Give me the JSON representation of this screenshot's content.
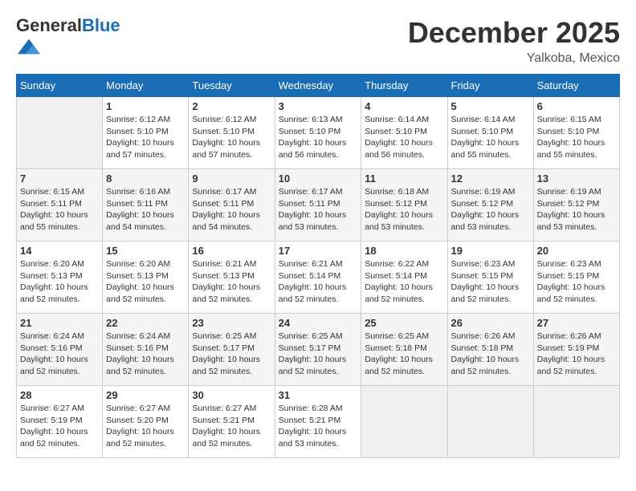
{
  "header": {
    "logo_general": "General",
    "logo_blue": "Blue",
    "month_title": "December 2025",
    "location": "Yalkoba, Mexico"
  },
  "columns": [
    "Sunday",
    "Monday",
    "Tuesday",
    "Wednesday",
    "Thursday",
    "Friday",
    "Saturday"
  ],
  "weeks": [
    [
      {
        "day": "",
        "info": ""
      },
      {
        "day": "1",
        "info": "Sunrise: 6:12 AM\nSunset: 5:10 PM\nDaylight: 10 hours and 57 minutes."
      },
      {
        "day": "2",
        "info": "Sunrise: 6:12 AM\nSunset: 5:10 PM\nDaylight: 10 hours and 57 minutes."
      },
      {
        "day": "3",
        "info": "Sunrise: 6:13 AM\nSunset: 5:10 PM\nDaylight: 10 hours and 56 minutes."
      },
      {
        "day": "4",
        "info": "Sunrise: 6:14 AM\nSunset: 5:10 PM\nDaylight: 10 hours and 56 minutes."
      },
      {
        "day": "5",
        "info": "Sunrise: 6:14 AM\nSunset: 5:10 PM\nDaylight: 10 hours and 55 minutes."
      },
      {
        "day": "6",
        "info": "Sunrise: 6:15 AM\nSunset: 5:10 PM\nDaylight: 10 hours and 55 minutes."
      }
    ],
    [
      {
        "day": "7",
        "info": "Sunrise: 6:15 AM\nSunset: 5:11 PM\nDaylight: 10 hours and 55 minutes."
      },
      {
        "day": "8",
        "info": "Sunrise: 6:16 AM\nSunset: 5:11 PM\nDaylight: 10 hours and 54 minutes."
      },
      {
        "day": "9",
        "info": "Sunrise: 6:17 AM\nSunset: 5:11 PM\nDaylight: 10 hours and 54 minutes."
      },
      {
        "day": "10",
        "info": "Sunrise: 6:17 AM\nSunset: 5:11 PM\nDaylight: 10 hours and 53 minutes."
      },
      {
        "day": "11",
        "info": "Sunrise: 6:18 AM\nSunset: 5:12 PM\nDaylight: 10 hours and 53 minutes."
      },
      {
        "day": "12",
        "info": "Sunrise: 6:19 AM\nSunset: 5:12 PM\nDaylight: 10 hours and 53 minutes."
      },
      {
        "day": "13",
        "info": "Sunrise: 6:19 AM\nSunset: 5:12 PM\nDaylight: 10 hours and 53 minutes."
      }
    ],
    [
      {
        "day": "14",
        "info": "Sunrise: 6:20 AM\nSunset: 5:13 PM\nDaylight: 10 hours and 52 minutes."
      },
      {
        "day": "15",
        "info": "Sunrise: 6:20 AM\nSunset: 5:13 PM\nDaylight: 10 hours and 52 minutes."
      },
      {
        "day": "16",
        "info": "Sunrise: 6:21 AM\nSunset: 5:13 PM\nDaylight: 10 hours and 52 minutes."
      },
      {
        "day": "17",
        "info": "Sunrise: 6:21 AM\nSunset: 5:14 PM\nDaylight: 10 hours and 52 minutes."
      },
      {
        "day": "18",
        "info": "Sunrise: 6:22 AM\nSunset: 5:14 PM\nDaylight: 10 hours and 52 minutes."
      },
      {
        "day": "19",
        "info": "Sunrise: 6:23 AM\nSunset: 5:15 PM\nDaylight: 10 hours and 52 minutes."
      },
      {
        "day": "20",
        "info": "Sunrise: 6:23 AM\nSunset: 5:15 PM\nDaylight: 10 hours and 52 minutes."
      }
    ],
    [
      {
        "day": "21",
        "info": "Sunrise: 6:24 AM\nSunset: 5:16 PM\nDaylight: 10 hours and 52 minutes."
      },
      {
        "day": "22",
        "info": "Sunrise: 6:24 AM\nSunset: 5:16 PM\nDaylight: 10 hours and 52 minutes."
      },
      {
        "day": "23",
        "info": "Sunrise: 6:25 AM\nSunset: 5:17 PM\nDaylight: 10 hours and 52 minutes."
      },
      {
        "day": "24",
        "info": "Sunrise: 6:25 AM\nSunset: 5:17 PM\nDaylight: 10 hours and 52 minutes."
      },
      {
        "day": "25",
        "info": "Sunrise: 6:25 AM\nSunset: 5:18 PM\nDaylight: 10 hours and 52 minutes."
      },
      {
        "day": "26",
        "info": "Sunrise: 6:26 AM\nSunset: 5:18 PM\nDaylight: 10 hours and 52 minutes."
      },
      {
        "day": "27",
        "info": "Sunrise: 6:26 AM\nSunset: 5:19 PM\nDaylight: 10 hours and 52 minutes."
      }
    ],
    [
      {
        "day": "28",
        "info": "Sunrise: 6:27 AM\nSunset: 5:19 PM\nDaylight: 10 hours and 52 minutes."
      },
      {
        "day": "29",
        "info": "Sunrise: 6:27 AM\nSunset: 5:20 PM\nDaylight: 10 hours and 52 minutes."
      },
      {
        "day": "30",
        "info": "Sunrise: 6:27 AM\nSunset: 5:21 PM\nDaylight: 10 hours and 52 minutes."
      },
      {
        "day": "31",
        "info": "Sunrise: 6:28 AM\nSunset: 5:21 PM\nDaylight: 10 hours and 53 minutes."
      },
      {
        "day": "",
        "info": ""
      },
      {
        "day": "",
        "info": ""
      },
      {
        "day": "",
        "info": ""
      }
    ]
  ]
}
